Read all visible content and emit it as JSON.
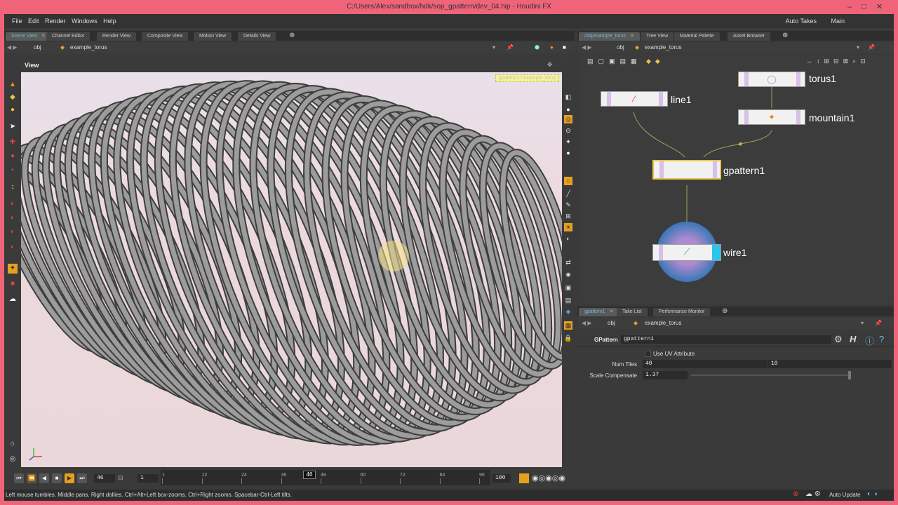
{
  "window": {
    "title": "C:/Users/Alex/sandbox/hdk/sop_gpattern/dev_04.hip - Houdini FX",
    "controls": [
      "minimize-icon",
      "maximize-icon",
      "close-icon"
    ]
  },
  "menubar": {
    "items": [
      "File",
      "Edit",
      "Render",
      "Windows",
      "Help"
    ],
    "auto_takes": "Auto Takes",
    "desktop": "Main"
  },
  "left_tabs": [
    "Scene View",
    "Channel Editor",
    "Render View",
    "Composite View",
    "Motion View",
    "Details View"
  ],
  "left_path": {
    "root": "obj",
    "node": "example_torus"
  },
  "viewport": {
    "label": "View",
    "badge": "gpattern1 / example_torus"
  },
  "timeline": {
    "current_frame": "46",
    "start_frame": "1",
    "end_frame": "100",
    "ticks": [
      "1",
      "12",
      "24",
      "36",
      "48",
      "60",
      "72",
      "84",
      "96"
    ],
    "playhead": "46"
  },
  "statusbar": {
    "message": "Left mouse tumbles. Middle pans. Right dollies. Ctrl+Alt+Left box-zooms. Ctrl+Right zooms. Spacebar-Ctrl-Left tilts.",
    "auto_update": "Auto Update"
  },
  "right_tabs": [
    "/obj/example_torus",
    "Tree View",
    "Material Palette",
    "Asset Browser"
  ],
  "right_path": {
    "root": "obj",
    "node": "example_torus"
  },
  "network": {
    "nodes": [
      {
        "name": "torus1",
        "icon": "torus-icon"
      },
      {
        "name": "line1",
        "icon": "line-icon"
      },
      {
        "name": "mountain1",
        "icon": "mountain-icon"
      },
      {
        "name": "gpattern1",
        "icon": "gpattern-icon"
      },
      {
        "name": "wire1",
        "icon": "wire-icon"
      }
    ]
  },
  "parm_tabs": [
    "gpattern1",
    "Take List",
    "Performance Monitor"
  ],
  "parm_path": {
    "root": "obj",
    "node": "example_torus"
  },
  "parms": {
    "type_label": "GPattern",
    "node_name": "gpattern1",
    "use_uv_label": "Use UV Attribute",
    "num_tiles_label": "Num Tiles",
    "num_tiles_x": "40",
    "num_tiles_y": "10",
    "scale_comp_label": "Scale Compensate",
    "scale_comp_value": "1.37"
  },
  "colors": {
    "window_frame": "#f0647a",
    "panel_bg": "#3a3a3a",
    "active_tab_text": "#6fb7d9",
    "wire_node_ring": "#3a78b8",
    "wire_flag": "#2ec4f0",
    "selected_node_outline": "#e6c547"
  }
}
